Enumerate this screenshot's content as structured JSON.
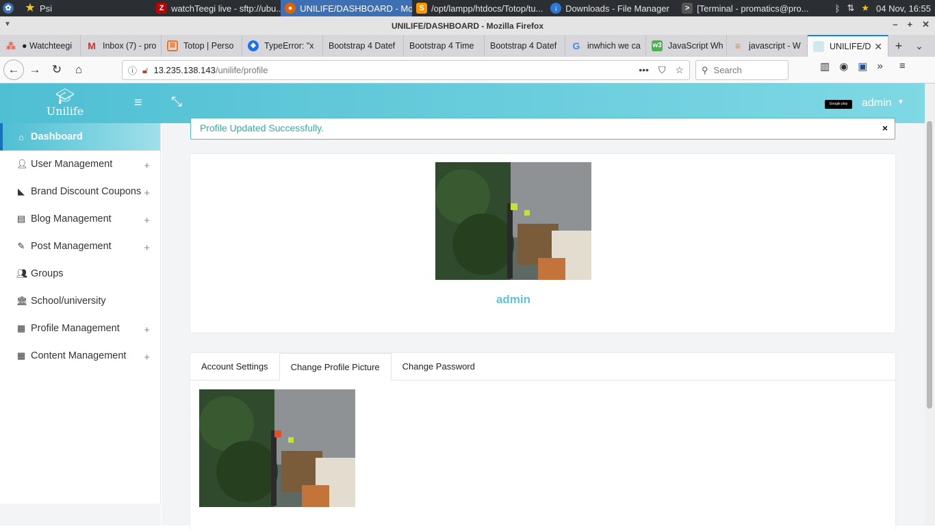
{
  "taskbar": {
    "items": [
      {
        "label": "Psi"
      },
      {
        "label": "watchTeegi live - sftp://ubu..."
      },
      {
        "label": "UNILIFE/DASHBOARD - Mo..."
      },
      {
        "label": "/opt/lampp/htdocs/Totop/tu..."
      },
      {
        "label": "Downloads - File Manager"
      },
      {
        "label": "[Terminal - promatics@pro..."
      }
    ],
    "clock": "04 Nov, 16:55"
  },
  "window": {
    "title": "UNILIFE/DASHBOARD - Mozilla Firefox"
  },
  "browser_tabs": [
    {
      "label": "● Watchteegi",
      "color": "#e8604c",
      "icon": "dots-icon"
    },
    {
      "label": "Inbox (7) - pro",
      "color": "#d93025",
      "icon": "gmail-icon"
    },
    {
      "label": "Totop | Perso",
      "color": "#f37321",
      "icon": "totop-icon"
    },
    {
      "label": "TypeError: \"x",
      "color": "#1a73e8",
      "icon": "puffin-icon"
    },
    {
      "label": "Bootstrap 4 Datef",
      "color": "",
      "icon": ""
    },
    {
      "label": "Bootstrap 4 Time",
      "color": "",
      "icon": ""
    },
    {
      "label": "Bootstrap 4 Datef",
      "color": "",
      "icon": ""
    },
    {
      "label": "inwhich we ca",
      "color": "#4285f4",
      "icon": "google-icon"
    },
    {
      "label": "JavaScript Wh",
      "color": "#4caf50",
      "icon": "w3-icon"
    },
    {
      "label": "javascript - W",
      "color": "#f48024",
      "icon": "stackoverflow-icon"
    },
    {
      "label": "UNILIFE/D",
      "color": "#cfe9ee",
      "icon": "unilife-icon"
    }
  ],
  "urlbar": {
    "host": "13.235.138.143",
    "path": "/unilife/profile"
  },
  "searchbar": {
    "placeholder": "Search"
  },
  "app": {
    "logo_text": "Unilife",
    "user_menu": "admin",
    "gplay_label": "Google play"
  },
  "sidebar": {
    "items": [
      {
        "label": "Dashboard",
        "icon": "home-icon",
        "expandable": false
      },
      {
        "label": "User Management",
        "icon": "user-icon",
        "expandable": true
      },
      {
        "label": "Brand Discount Coupons",
        "icon": "tag-icon",
        "expandable": true
      },
      {
        "label": "Blog Management",
        "icon": "file-icon",
        "expandable": true
      },
      {
        "label": "Post Management",
        "icon": "edit-icon",
        "expandable": true
      },
      {
        "label": "Groups",
        "icon": "users-icon",
        "expandable": false
      },
      {
        "label": "School/university",
        "icon": "institution-icon",
        "expandable": false
      },
      {
        "label": "Profile Management",
        "icon": "grid-icon",
        "expandable": true
      },
      {
        "label": "Content Management",
        "icon": "grid-icon",
        "expandable": true
      }
    ]
  },
  "alert": {
    "message": "Profile Updated Successfully.",
    "close": "×"
  },
  "profile": {
    "name": "admin"
  },
  "profile_tabs": [
    {
      "label": "Account Settings"
    },
    {
      "label": "Change Profile Picture"
    },
    {
      "label": "Change Password"
    }
  ],
  "colors": {
    "accent": "#4fbfd3",
    "alert_text": "#29b0a0",
    "profile_name": "#5fc4d3"
  }
}
